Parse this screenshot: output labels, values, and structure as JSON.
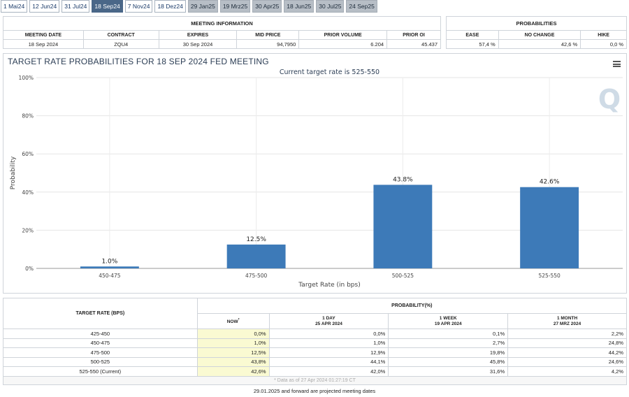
{
  "tabs": [
    {
      "label": "1 Mai24",
      "state": "normal"
    },
    {
      "label": "12 Jun24",
      "state": "normal"
    },
    {
      "label": "31 Jul24",
      "state": "normal"
    },
    {
      "label": "18 Sep24",
      "state": "active"
    },
    {
      "label": "7 Nov24",
      "state": "normal"
    },
    {
      "label": "18 Dez24",
      "state": "normal"
    },
    {
      "label": "29 Jan25",
      "state": "past"
    },
    {
      "label": "19 Mrz25",
      "state": "past"
    },
    {
      "label": "30 Apr25",
      "state": "past"
    },
    {
      "label": "18 Jun25",
      "state": "past"
    },
    {
      "label": "30 Jul25",
      "state": "past"
    },
    {
      "label": "24 Sep25",
      "state": "past"
    }
  ],
  "meeting_info": {
    "title": "MEETING INFORMATION",
    "headers": [
      "MEETING DATE",
      "CONTRACT",
      "EXPIRES",
      "MID PRICE",
      "PRIOR VOLUME",
      "PRIOR OI"
    ],
    "row": [
      "18 Sep 2024",
      "ZQU4",
      "30 Sep 2024",
      "94,7950",
      "6.204",
      "45.437"
    ]
  },
  "probabilities": {
    "title": "PROBABILITIES",
    "headers": [
      "EASE",
      "NO CHANGE",
      "HIKE"
    ],
    "row": [
      "57,4 %",
      "42,6 %",
      "0,0 %"
    ]
  },
  "chart": {
    "title": "TARGET RATE PROBABILITIES FOR 18 SEP 2024 FED MEETING",
    "watermark": "Q"
  },
  "chart_data": {
    "type": "bar",
    "title": "TARGET RATE PROBABILITIES FOR 18 SEP 2024 FED MEETING",
    "subtitle": "Current target rate is 525-550",
    "xlabel": "Target Rate (in bps)",
    "ylabel": "Probability",
    "categories": [
      "450-475",
      "475-500",
      "500-525",
      "525-550"
    ],
    "values": [
      1.0,
      12.5,
      43.8,
      42.6
    ],
    "data_labels": [
      "1.0%",
      "12.5%",
      "43.8%",
      "42.6%"
    ],
    "yticks": [
      "0%",
      "20%",
      "40%",
      "60%",
      "80%",
      "100%"
    ],
    "ylim": [
      0,
      100
    ],
    "bar_color": "#3d7ab8",
    "grid": true,
    "legend": "none"
  },
  "prob_table": {
    "col_target": "TARGET RATE (BPS)",
    "col_prob": "PROBABILITY(%)",
    "subheaders": [
      {
        "line1": "NOW",
        "line2": "",
        "mark": "*"
      },
      {
        "line1": "1 DAY",
        "line2": "25 APR 2024",
        "mark": ""
      },
      {
        "line1": "1 WEEK",
        "line2": "19 APR 2024",
        "mark": ""
      },
      {
        "line1": "1 MONTH",
        "line2": "27 MRZ 2024",
        "mark": ""
      }
    ],
    "rows": [
      {
        "rate": "425-450",
        "now": "0,0%",
        "d1": "0,0%",
        "w1": "0,1%",
        "m1": "2,2%"
      },
      {
        "rate": "450-475",
        "now": "1,0%",
        "d1": "1,0%",
        "w1": "2,7%",
        "m1": "24,8%"
      },
      {
        "rate": "475-500",
        "now": "12,5%",
        "d1": "12,9%",
        "w1": "19,8%",
        "m1": "44,2%"
      },
      {
        "rate": "500-525",
        "now": "43,8%",
        "d1": "44,1%",
        "w1": "45,8%",
        "m1": "24,6%"
      },
      {
        "rate": "525-550 (Current)",
        "now": "42,6%",
        "d1": "42,0%",
        "w1": "31,6%",
        "m1": "4,2%"
      }
    ],
    "note": "* Data as of 27 Apr 2024 01:27:19 CT"
  },
  "footer": "29.01.2025 and forward are projected meeting dates"
}
